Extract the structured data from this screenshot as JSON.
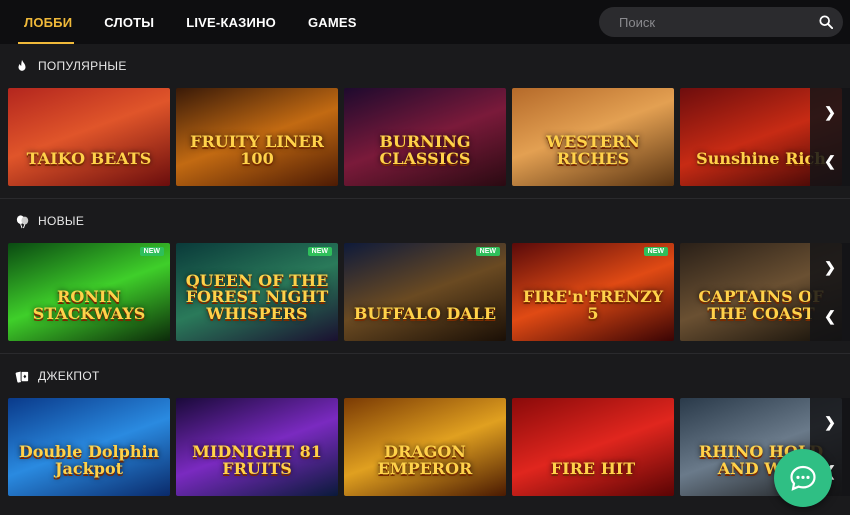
{
  "nav": {
    "tabs": [
      {
        "label": "ЛОББИ",
        "active": true
      },
      {
        "label": "СЛОТЫ",
        "active": false
      },
      {
        "label": "LIVE-КАЗИНО",
        "active": false
      },
      {
        "label": "GAMES",
        "active": false
      }
    ],
    "search_placeholder": "Поиск"
  },
  "accent_color": "#f0b93a",
  "sections": [
    {
      "title": "ПОПУЛЯРНЫЕ",
      "icon": "fire-icon",
      "games": [
        {
          "name": "TAIKO BEATS",
          "bg": "linear-gradient(160deg,#b3261e 0%,#e0552a 45%,#6a0d0d 100%)"
        },
        {
          "name": "FRUITY LINER 100",
          "bg": "linear-gradient(160deg,#3a1a08 0%,#c26a12 50%,#4d1b04 100%)"
        },
        {
          "name": "BURNING CLASSICS",
          "bg": "linear-gradient(160deg,#1e0a2e 0%,#7a1a3a 50%,#2a0a12 100%)"
        },
        {
          "name": "WESTERN RICHES",
          "bg": "linear-gradient(160deg,#b56a2a 0%,#e3a052 45%,#5a3412 100%)"
        },
        {
          "name": "Sunshine Rich",
          "bg": "linear-gradient(160deg,#6e0d0d 0%,#c72b14 50%,#3a0505 100%)"
        }
      ]
    },
    {
      "title": "НОВЫЕ",
      "icon": "balloons-icon",
      "games": [
        {
          "name": "RONIN STACKWAYS",
          "badge": "NEW",
          "bg": "linear-gradient(160deg,#0a4a12 0%,#3fcf2a 50%,#0c2a0a 100%)"
        },
        {
          "name": "QUEEN OF THE FOREST NIGHT WHISPERS",
          "badge": "NEW",
          "bg": "linear-gradient(160deg,#0a3a3a 0%,#2a7a5a 50%,#1a1030 100%)"
        },
        {
          "name": "BUFFALO DALE",
          "badge": "NEW",
          "bg": "linear-gradient(160deg,#0e1a3a 0%,#6a4a22 50%,#1a0f06 100%)"
        },
        {
          "name": "FIRE'n'FRENZY 5",
          "badge": "NEW",
          "bg": "linear-gradient(160deg,#5a0a0a 0%,#e04a14 50%,#3a0404 100%)"
        },
        {
          "name": "CAPTAINS OF THE COAST",
          "bg": "linear-gradient(160deg,#2a2018 0%,#6a5032 50%,#14100a 100%)"
        }
      ]
    },
    {
      "title": "ДЖЕКПОТ",
      "icon": "cards-icon",
      "games": [
        {
          "name": "Double Dolphin Jackpot",
          "bg": "linear-gradient(160deg,#0a3a8a 0%,#2a8ae0 50%,#0a2a6a 100%)"
        },
        {
          "name": "MIDNIGHT 81 FRUITS",
          "bg": "linear-gradient(160deg,#1a0a3a 0%,#7a2ac0 50%,#0a1a3a 100%)"
        },
        {
          "name": "DRAGON EMPEROR",
          "bg": "linear-gradient(160deg,#7a3a04 0%,#e0a020 50%,#4a1a02 100%)"
        },
        {
          "name": "FIRE HIT",
          "bg": "linear-gradient(160deg,#8a0a0a 0%,#e0261e 50%,#5a0404 100%)"
        },
        {
          "name": "RHINO HOLD AND WIN",
          "bg": "linear-gradient(160deg,#2a3a4a 0%,#6a7a8a 50%,#1a1a1a 100%)"
        }
      ]
    }
  ]
}
